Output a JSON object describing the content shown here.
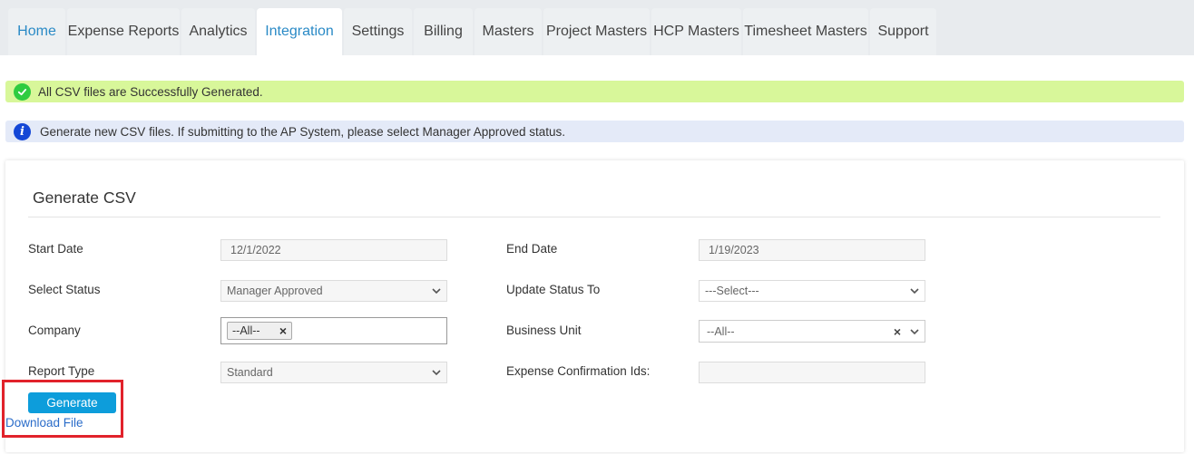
{
  "nav": {
    "tabs": [
      {
        "label": "Home"
      },
      {
        "label": "Expense Reports"
      },
      {
        "label": "Analytics"
      },
      {
        "label": "Integration",
        "active": true
      },
      {
        "label": "Settings"
      },
      {
        "label": "Billing"
      },
      {
        "label": "Masters"
      },
      {
        "label": "Project Masters"
      },
      {
        "label": "HCP Masters"
      },
      {
        "label": "Timesheet Masters"
      },
      {
        "label": "Support"
      }
    ]
  },
  "alerts": {
    "success": {
      "text": "All CSV files are Successfully Generated.",
      "icon": "check-circle-icon",
      "color": "#d8f79a"
    },
    "info": {
      "text": "Generate new CSV files. If submitting to the AP System, please select Manager Approved status.",
      "icon": "info-circle-icon",
      "color": "#e4eaf8"
    }
  },
  "form": {
    "title": "Generate CSV",
    "start_date": {
      "label": "Start Date",
      "value": "12/1/2022"
    },
    "end_date": {
      "label": "End Date",
      "value": "1/19/2023"
    },
    "select_status": {
      "label": "Select Status",
      "value": "Manager Approved"
    },
    "update_status_to": {
      "label": "Update Status To",
      "value": "---Select---"
    },
    "company": {
      "label": "Company",
      "chip": "--All--"
    },
    "business_unit": {
      "label": "Business Unit",
      "value": "--All--"
    },
    "report_type": {
      "label": "Report Type",
      "value": "Standard"
    },
    "expense_confirmation_ids": {
      "label": "Expense Confirmation Ids:",
      "value": ""
    },
    "generate_label": "Generate",
    "download_label": "Download File"
  },
  "colors": {
    "accent": "#2a8ac6",
    "button": "#0d9ddb",
    "highlight": "#e1222b"
  }
}
